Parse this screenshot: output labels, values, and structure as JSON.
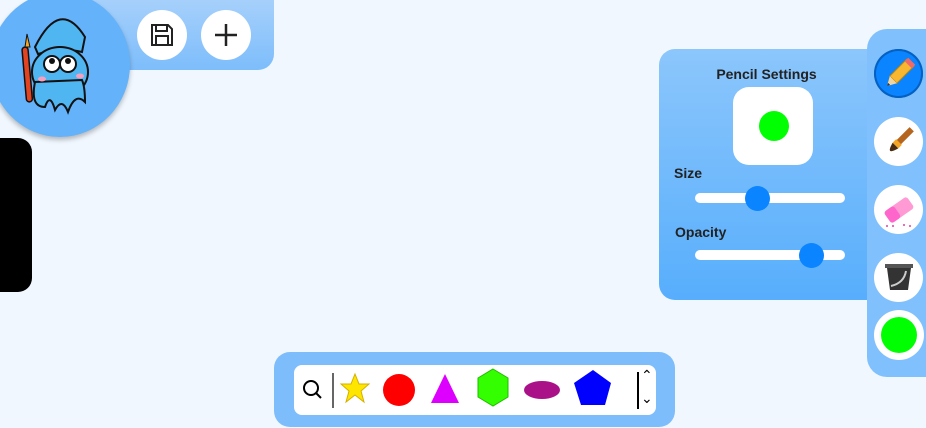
{
  "header": {
    "save_icon": "floppy-disk-icon",
    "add_icon": "plus-icon"
  },
  "settings": {
    "title": "Pencil Settings",
    "preview_color": "#00ff00",
    "size_label": "Size",
    "size_value_percent": 41,
    "opacity_label": "Opacity",
    "opacity_value_percent": 77
  },
  "tools": [
    {
      "name": "pencil",
      "active": true
    },
    {
      "name": "brush"
    },
    {
      "name": "eraser"
    },
    {
      "name": "bucket"
    },
    {
      "name": "color",
      "color": "#00ff00"
    }
  ],
  "shapes": [
    {
      "name": "star",
      "color": "#ffe600"
    },
    {
      "name": "circle",
      "color": "#ff0000"
    },
    {
      "name": "triangle",
      "color": "#dd00ff"
    },
    {
      "name": "hexagon",
      "color": "#33ff00"
    },
    {
      "name": "ellipse",
      "color": "#aa1188"
    },
    {
      "name": "pentagon",
      "color": "#0000ff"
    }
  ],
  "colors": {
    "accent": "#0a84ff",
    "panel": "#7dbdfb"
  }
}
